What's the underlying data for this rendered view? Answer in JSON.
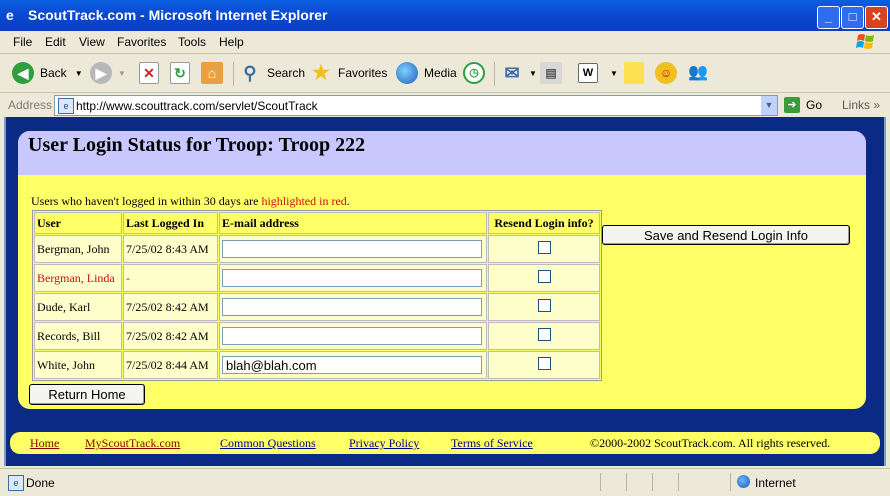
{
  "window": {
    "title": "ScoutTrack.com - Microsoft Internet Explorer",
    "min_glyph": "_",
    "max_glyph": "□",
    "close_glyph": "✕"
  },
  "menu": [
    "File",
    "Edit",
    "View",
    "Favorites",
    "Tools",
    "Help"
  ],
  "toolbar": {
    "back": "Back",
    "search": "Search",
    "favorites": "Favorites",
    "media": "Media"
  },
  "address": {
    "label": "Address",
    "url": "http://www.scouttrack.com/servlet/ScoutTrack",
    "go": "Go",
    "links": "Links"
  },
  "page": {
    "heading": "User Login Status for Troop: Troop 222",
    "notice_prefix": "Users who haven't logged in within 30 days are ",
    "notice_highlight": "highlighted in red",
    "notice_suffix": ".",
    "columns": [
      "User",
      "Last Logged In",
      "E-mail address",
      "Resend Login info?"
    ],
    "rows": [
      {
        "user": "Bergman, John",
        "last": "7/25/02 8:43 AM",
        "email": "",
        "late": false,
        "resend": false
      },
      {
        "user": "Bergman, Linda",
        "last": "-",
        "email": "",
        "late": true,
        "resend": false
      },
      {
        "user": "Dude, Karl",
        "last": "7/25/02 8:42 AM",
        "email": "",
        "late": false,
        "resend": false
      },
      {
        "user": "Records, Bill",
        "last": "7/25/02 8:42 AM",
        "email": "",
        "late": false,
        "resend": false
      },
      {
        "user": "White, John",
        "last": "7/25/02 8:44 AM",
        "email": "blah@blah.com",
        "late": false,
        "resend": false
      }
    ],
    "save_button": "Save and Resend Login Info",
    "home_button": "Return Home"
  },
  "footer": {
    "home": "Home",
    "myscouttrack": "MyScoutTrack.com",
    "questions": "Common Questions",
    "privacy": "Privacy Policy",
    "terms": "Terms of Service",
    "copyright": "©2000-2002 ScoutTrack.com. All rights reserved."
  },
  "status": {
    "text": "Done",
    "zone": "Internet"
  },
  "colors": {
    "panel": "#ffff66",
    "panel_header": "#c8c8ff",
    "page_background": "#0a2a86",
    "late_user": "#c81010"
  },
  "icons": [
    "ie-page-icon",
    "windows-flag-icon",
    "back-arrow-icon",
    "forward-arrow-icon",
    "stop-icon",
    "refresh-icon",
    "home-icon",
    "search-icon",
    "favorites-star-icon",
    "media-icon",
    "history-icon",
    "mail-icon",
    "print-icon",
    "edit-icon",
    "discuss-icon",
    "messenger-icon",
    "go-arrow-icon",
    "internet-zone-icon"
  ]
}
